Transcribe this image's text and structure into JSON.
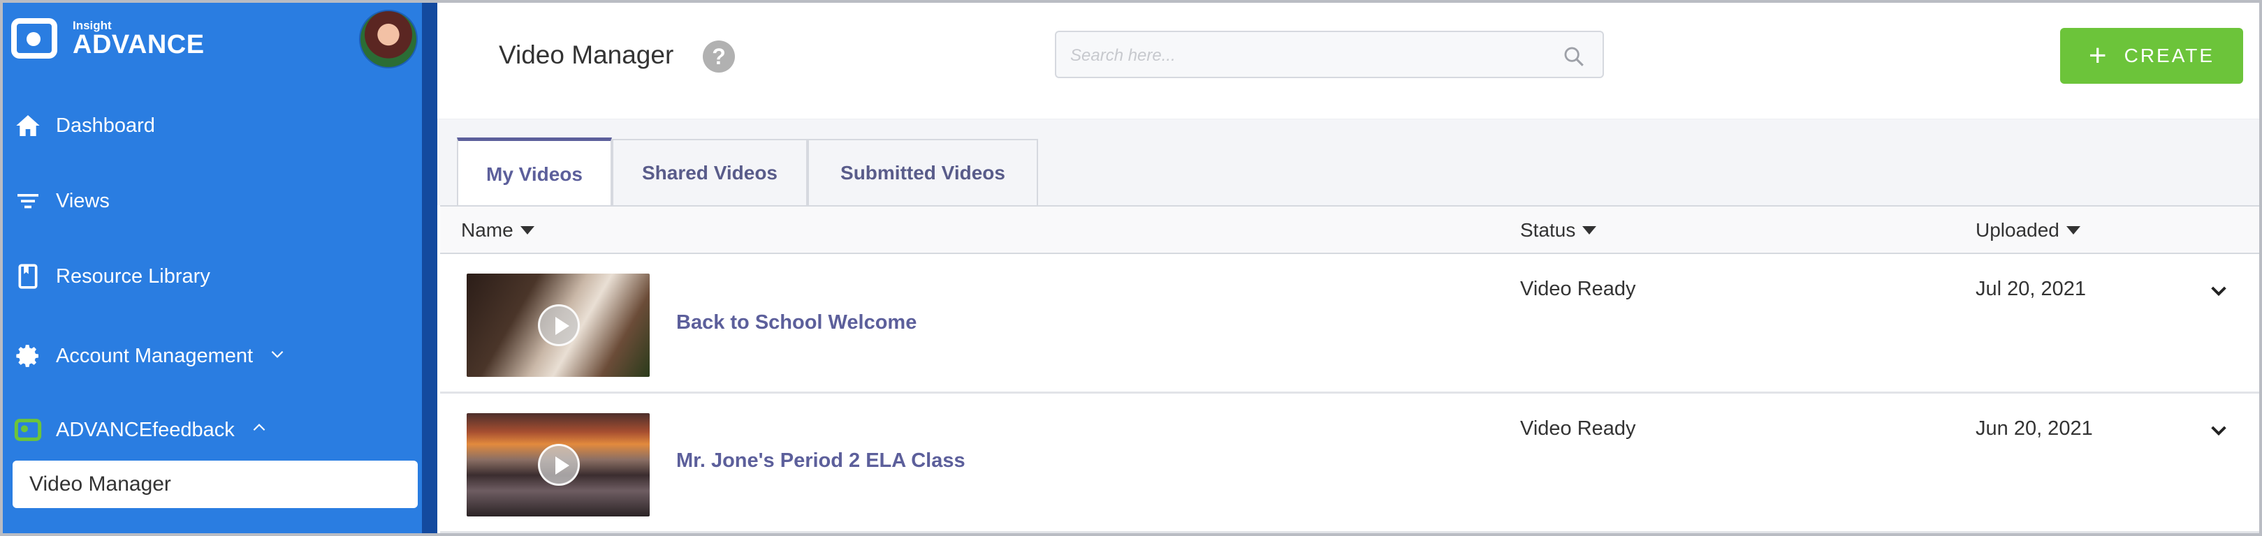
{
  "app": {
    "logo_small": "Insight",
    "logo_big": "ADVANCE",
    "brand_color": "#2a7de1",
    "accent_green": "#6cc43a"
  },
  "sidebar": {
    "items": [
      {
        "label": "Dashboard",
        "icon": "home-icon"
      },
      {
        "label": "Views",
        "icon": "filter-icon"
      },
      {
        "label": "Resource Library",
        "icon": "bookmark-icon"
      },
      {
        "label": "Account Management",
        "icon": "gear-icon",
        "expandable": true,
        "expanded": false
      },
      {
        "label": "ADVANCEfeedback",
        "icon": "advancefeedback-icon",
        "expandable": true,
        "expanded": true
      }
    ],
    "selected_subitem": "Video Manager"
  },
  "header": {
    "title": "Video Manager",
    "help_glyph": "?",
    "search_placeholder": "Search here...",
    "create_label": "CREATE"
  },
  "tabs": [
    {
      "label": "My Videos",
      "active": true
    },
    {
      "label": "Shared Videos",
      "active": false
    },
    {
      "label": "Submitted Videos",
      "active": false
    }
  ],
  "table": {
    "columns": [
      "Name",
      "Status",
      "Uploaded"
    ],
    "rows": [
      {
        "title": "Back to School Welcome",
        "status": "Video Ready",
        "uploaded": "Jul 20, 2021"
      },
      {
        "title": "Mr. Jone's Period 2 ELA Class",
        "status": "Video Ready",
        "uploaded": "Jun 20, 2021"
      }
    ]
  }
}
